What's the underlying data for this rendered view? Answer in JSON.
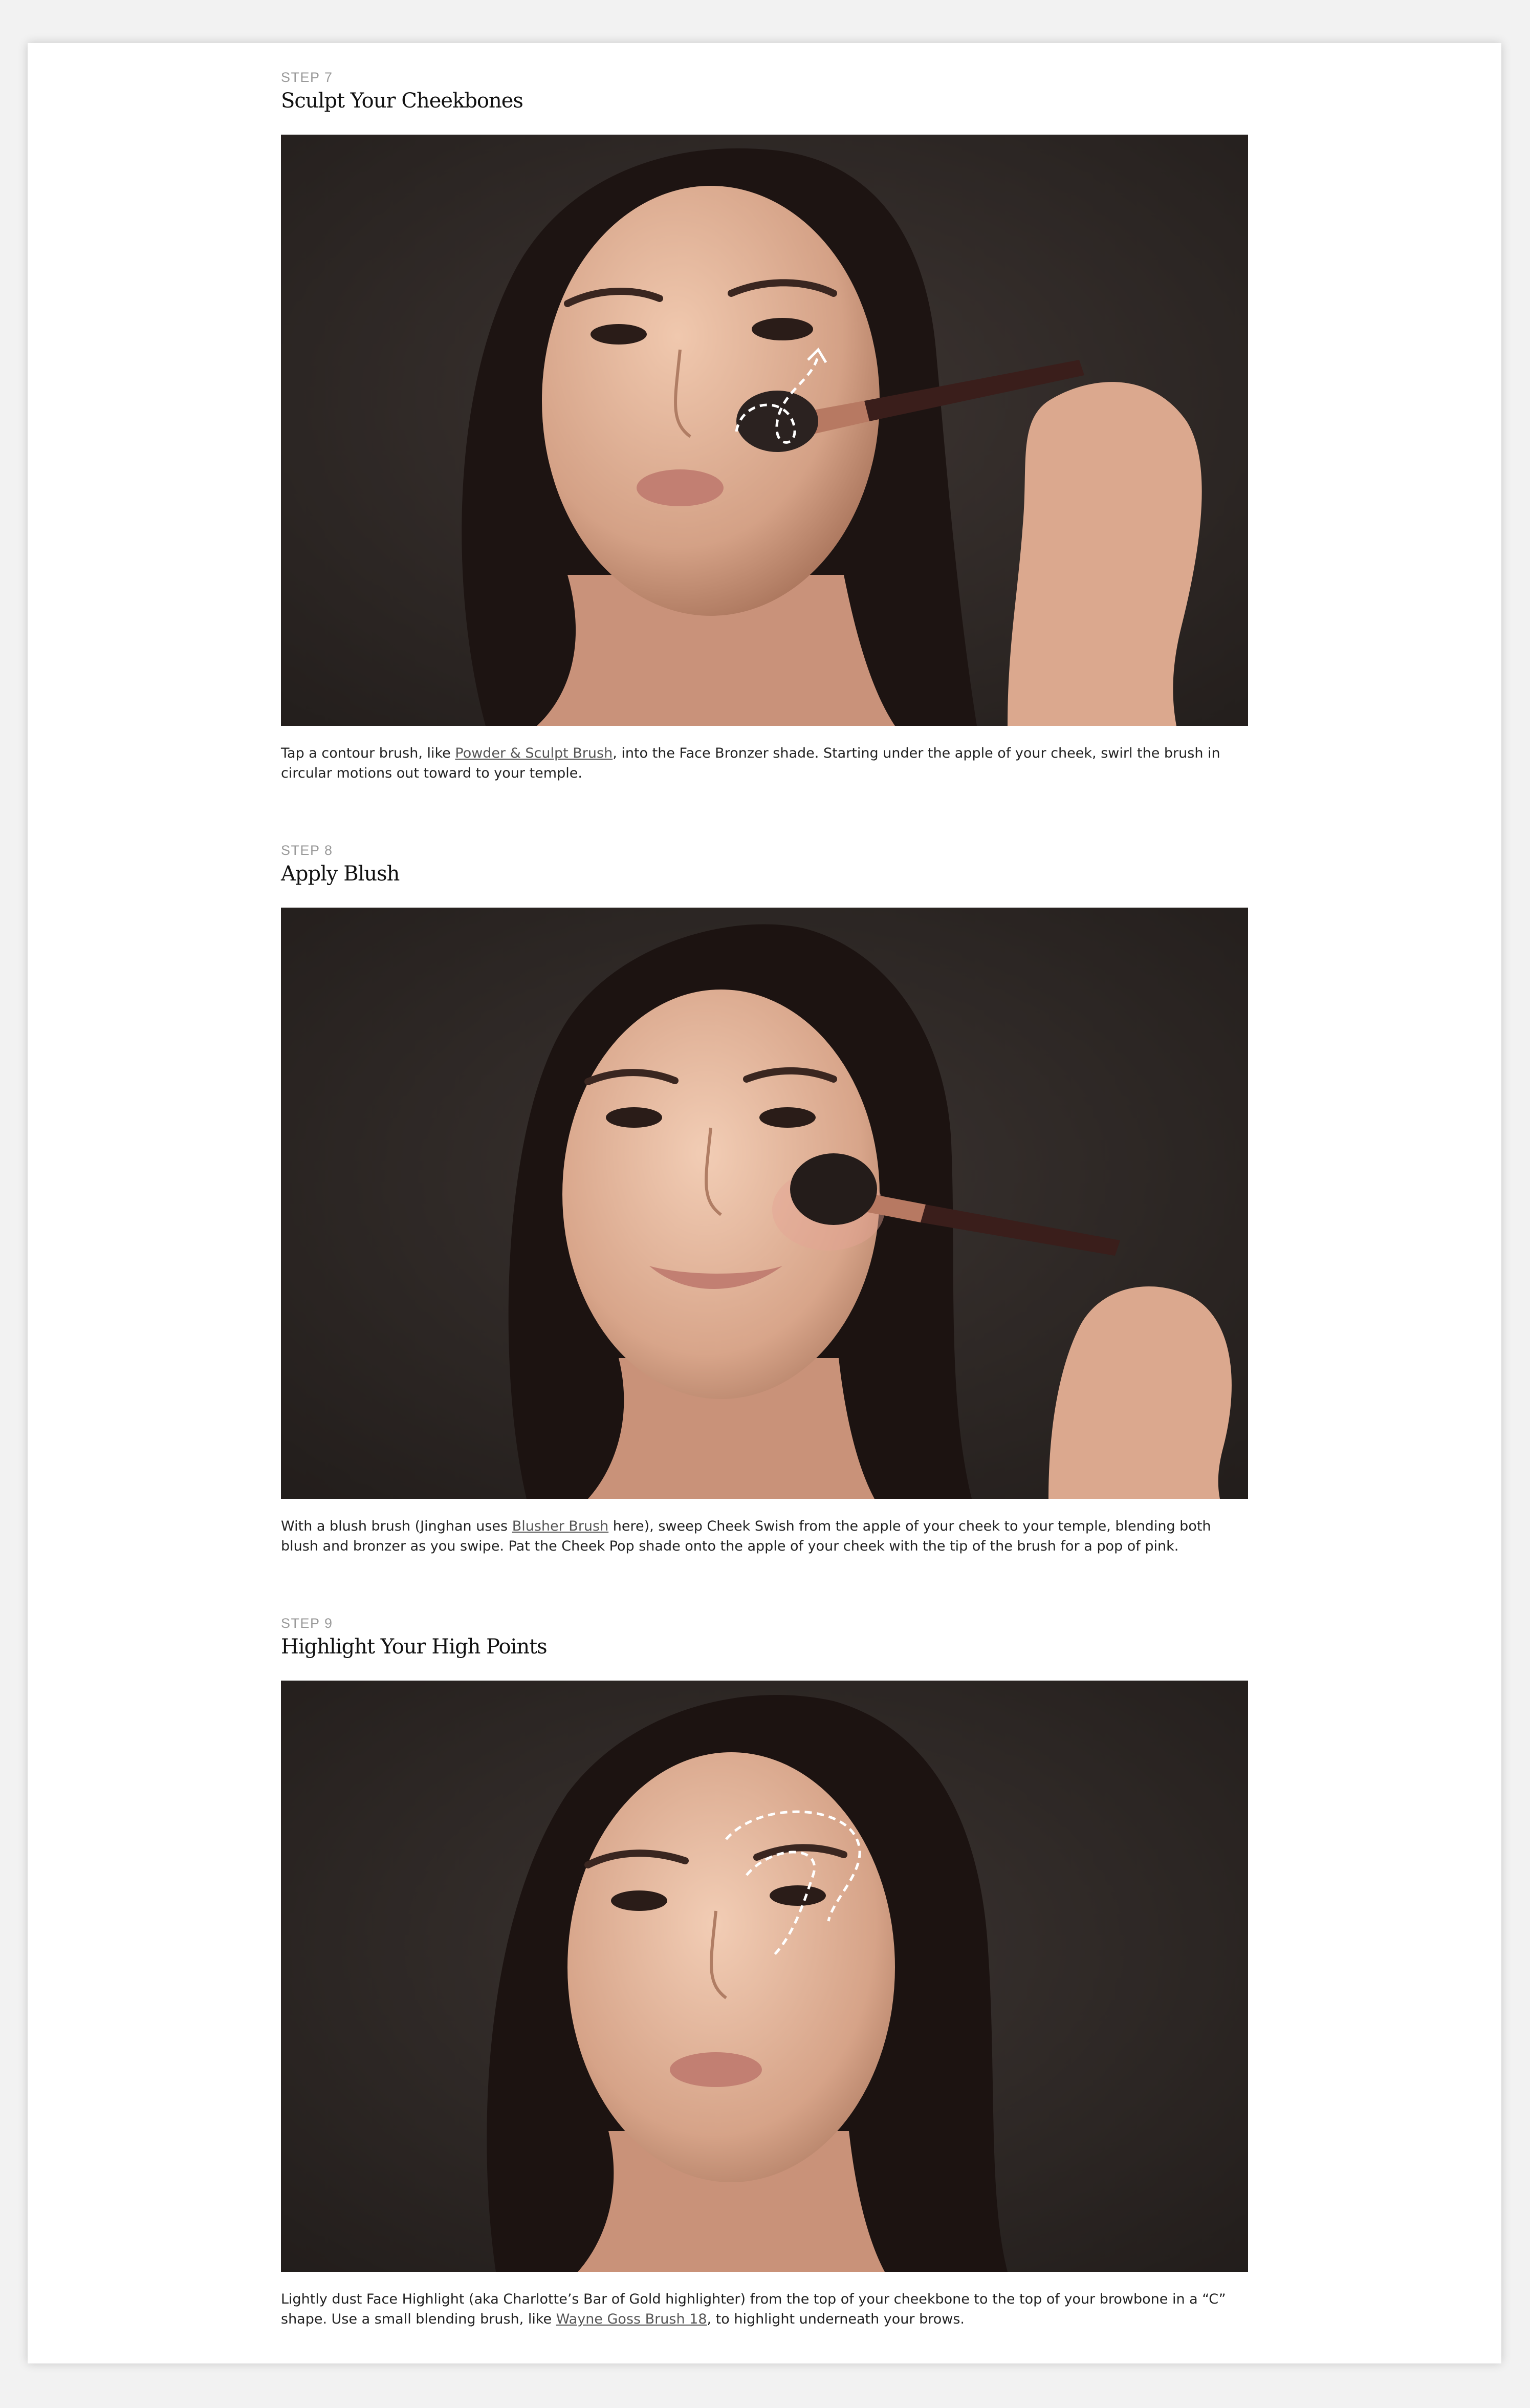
{
  "steps": [
    {
      "label": "STEP 7",
      "title": "Sculpt Your Cheekbones",
      "photo_alt": "model",
      "caption": {
        "pre": "Tap a contour brush, like ",
        "link": "Powder & Sculpt Brush",
        "post": ", into the Face Bronzer shade. Starting under the apple of your cheek, swirl the brush in circular motions out toward to your temple."
      }
    },
    {
      "label": "STEP 8",
      "title": "Apply Blush",
      "photo_alt": "model",
      "caption": {
        "pre": "With a blush brush (Jinghan uses ",
        "link": "Blusher Brush",
        "post": " here), sweep Cheek Swish from the apple of your cheek to your temple, blending both blush and bronzer as you swipe. Pat the Cheek Pop shade onto the apple of your cheek with the tip of the brush for a pop of pink."
      }
    },
    {
      "label": "STEP 9",
      "title": "Highlight Your High Points",
      "photo_alt": "model",
      "caption": {
        "pre": "Lightly dust Face Highlight (aka Charlotte’s Bar of Gold highlighter) from the top of your cheekbone to the top of your browbone in a “C” shape. Use a small blending brush, like ",
        "link": "Wayne Goss Brush 18",
        "post": ", to highlight underneath your brows."
      }
    }
  ]
}
